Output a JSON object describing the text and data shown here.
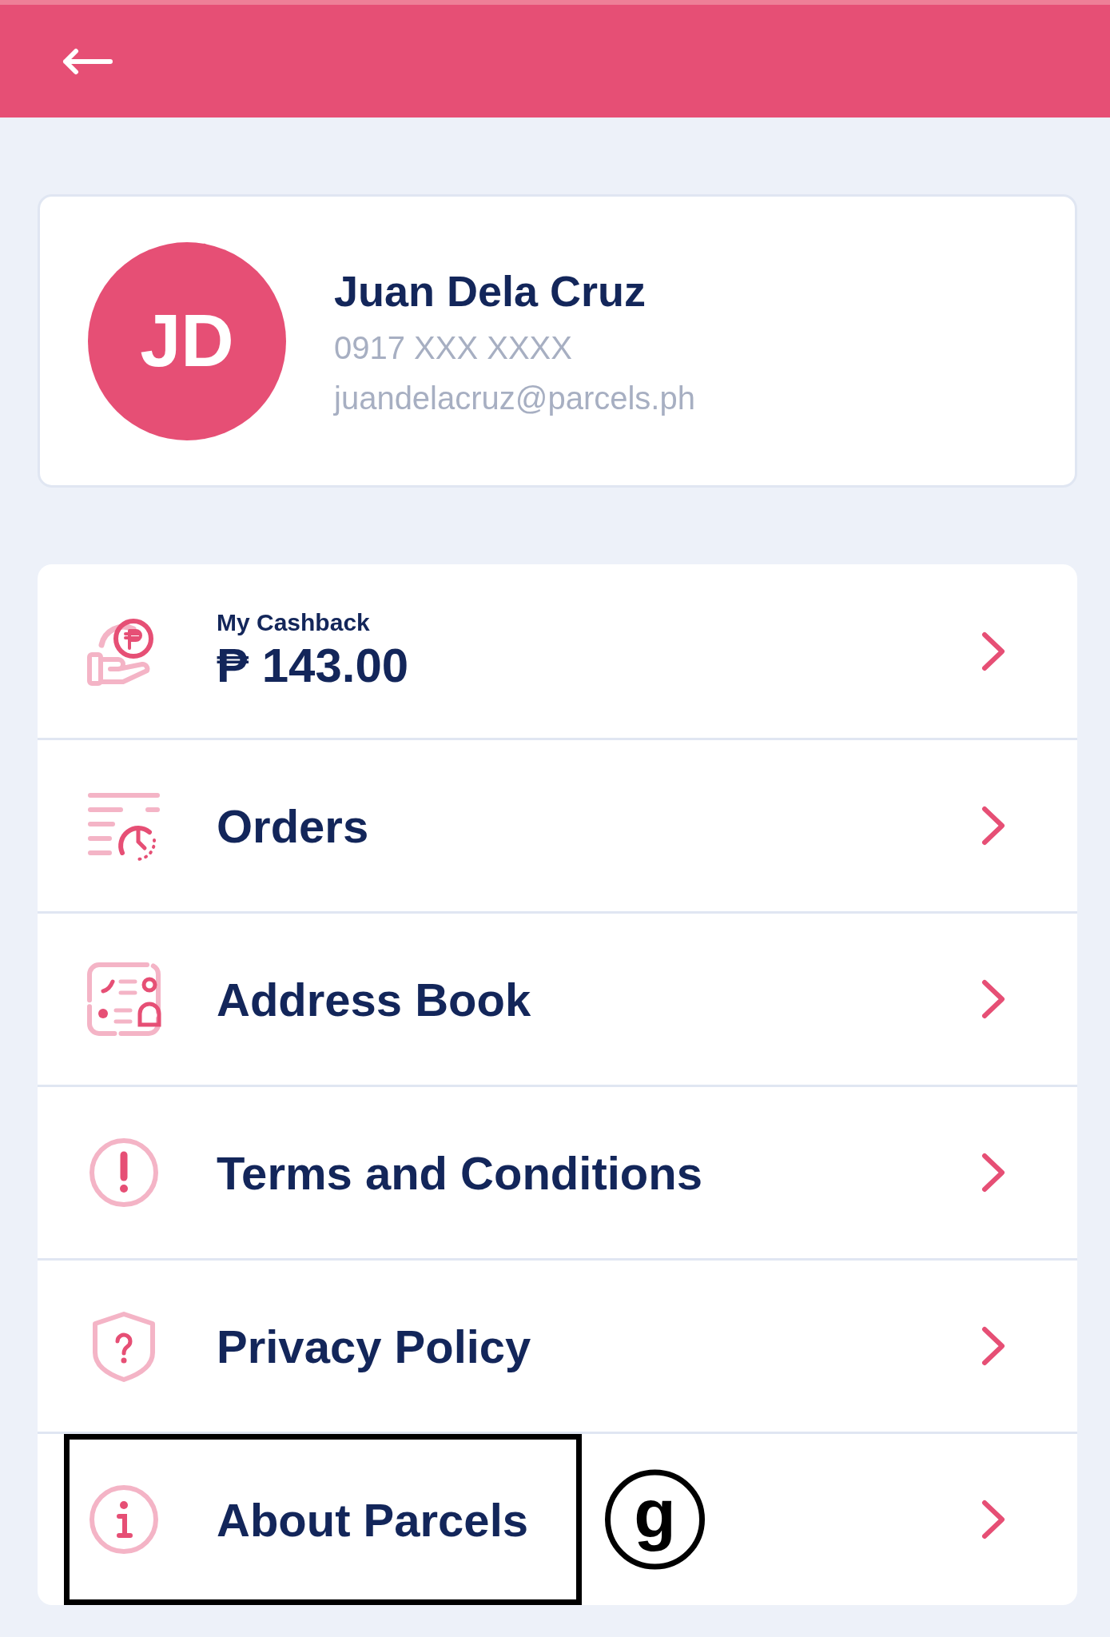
{
  "profile": {
    "initials": "JD",
    "name": "Juan Dela Cruz",
    "phone": "0917 XXX XXXX",
    "email": "juandelacruz@parcels.ph"
  },
  "menu": [
    {
      "kind": "cashback",
      "label": "My Cashback",
      "value": "₱ 143.00",
      "highlighted": false
    },
    {
      "kind": "link",
      "label": "Orders",
      "highlighted": false
    },
    {
      "kind": "link",
      "label": "Address Book",
      "highlighted": false
    },
    {
      "kind": "link",
      "label": "Terms and Conditions",
      "highlighted": false
    },
    {
      "kind": "link",
      "label": "Privacy Policy",
      "highlighted": false
    },
    {
      "kind": "link",
      "label": "About Parcels",
      "highlighted": true
    }
  ],
  "callout": {
    "label": "g"
  }
}
